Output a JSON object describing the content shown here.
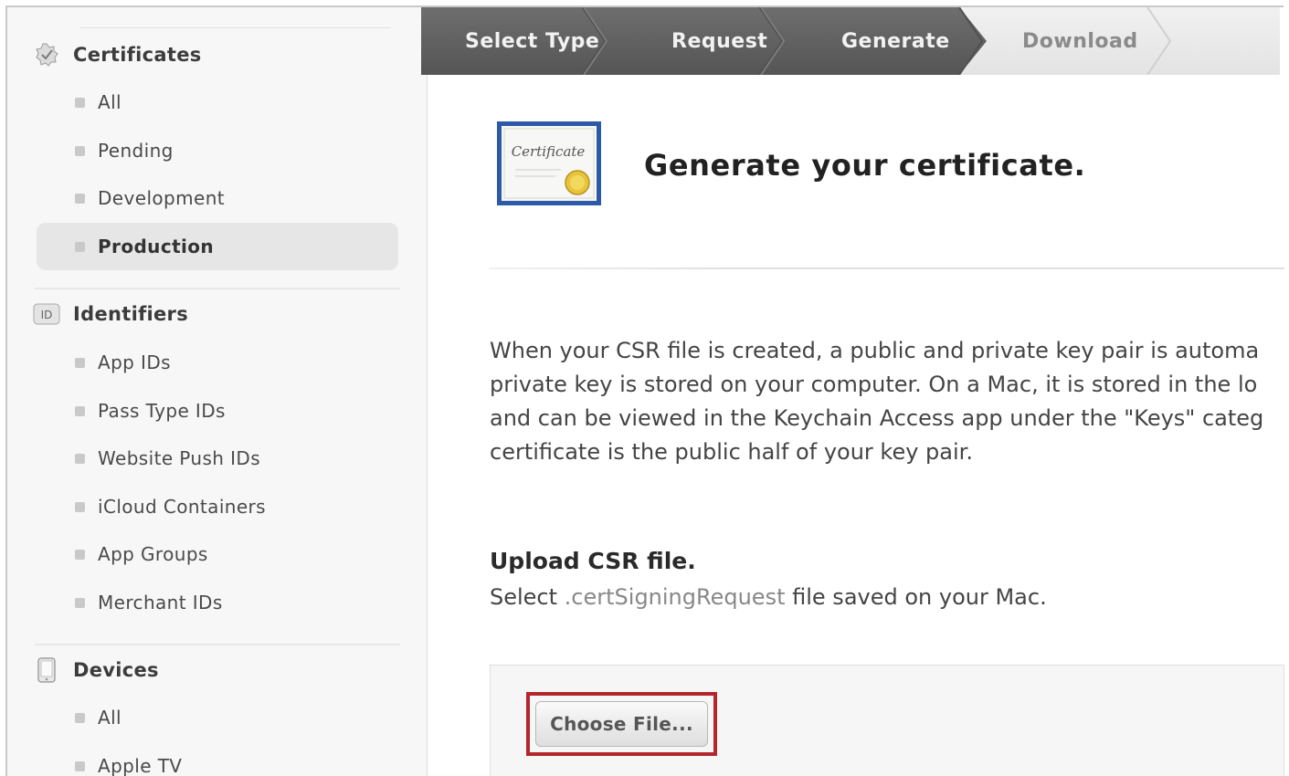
{
  "sidebar": {
    "certificates": {
      "title": "Certificates",
      "icon": "certificate-badge-icon",
      "items": [
        {
          "label": "All",
          "active": false
        },
        {
          "label": "Pending",
          "active": false
        },
        {
          "label": "Development",
          "active": false
        },
        {
          "label": "Production",
          "active": true
        }
      ]
    },
    "identifiers": {
      "title": "Identifiers",
      "icon_text": "ID",
      "items": [
        {
          "label": "App IDs"
        },
        {
          "label": "Pass Type IDs"
        },
        {
          "label": "Website Push IDs"
        },
        {
          "label": "iCloud Containers"
        },
        {
          "label": "App Groups"
        },
        {
          "label": "Merchant IDs"
        }
      ]
    },
    "devices": {
      "title": "Devices",
      "icon": "device-phone-icon",
      "items": [
        {
          "label": "All"
        },
        {
          "label": "Apple TV"
        }
      ]
    }
  },
  "steps": {
    "items": [
      "Select Type",
      "Request",
      "Generate",
      "Download"
    ],
    "current": "Generate",
    "colors": {
      "completed": "#5f5f5f",
      "upcoming": "#e9e9e9"
    }
  },
  "main": {
    "cert_image_text": "Certificate",
    "title": "Generate your certificate.",
    "paragraph_lines": [
      "When your CSR file is created, a public and private key pair is automa",
      "private key is stored on your computer. On a Mac, it is stored in the lo",
      "and can be viewed in the Keychain Access app under the \"Keys\" categ",
      "certificate is the public half of your key pair."
    ],
    "upload": {
      "title": "Upload CSR file.",
      "desc_prefix": "Select ",
      "desc_ext": ".certSigningRequest",
      "desc_suffix": " file saved on your Mac.",
      "button_label": "Choose File..."
    },
    "highlight_color": "#b3262c"
  }
}
